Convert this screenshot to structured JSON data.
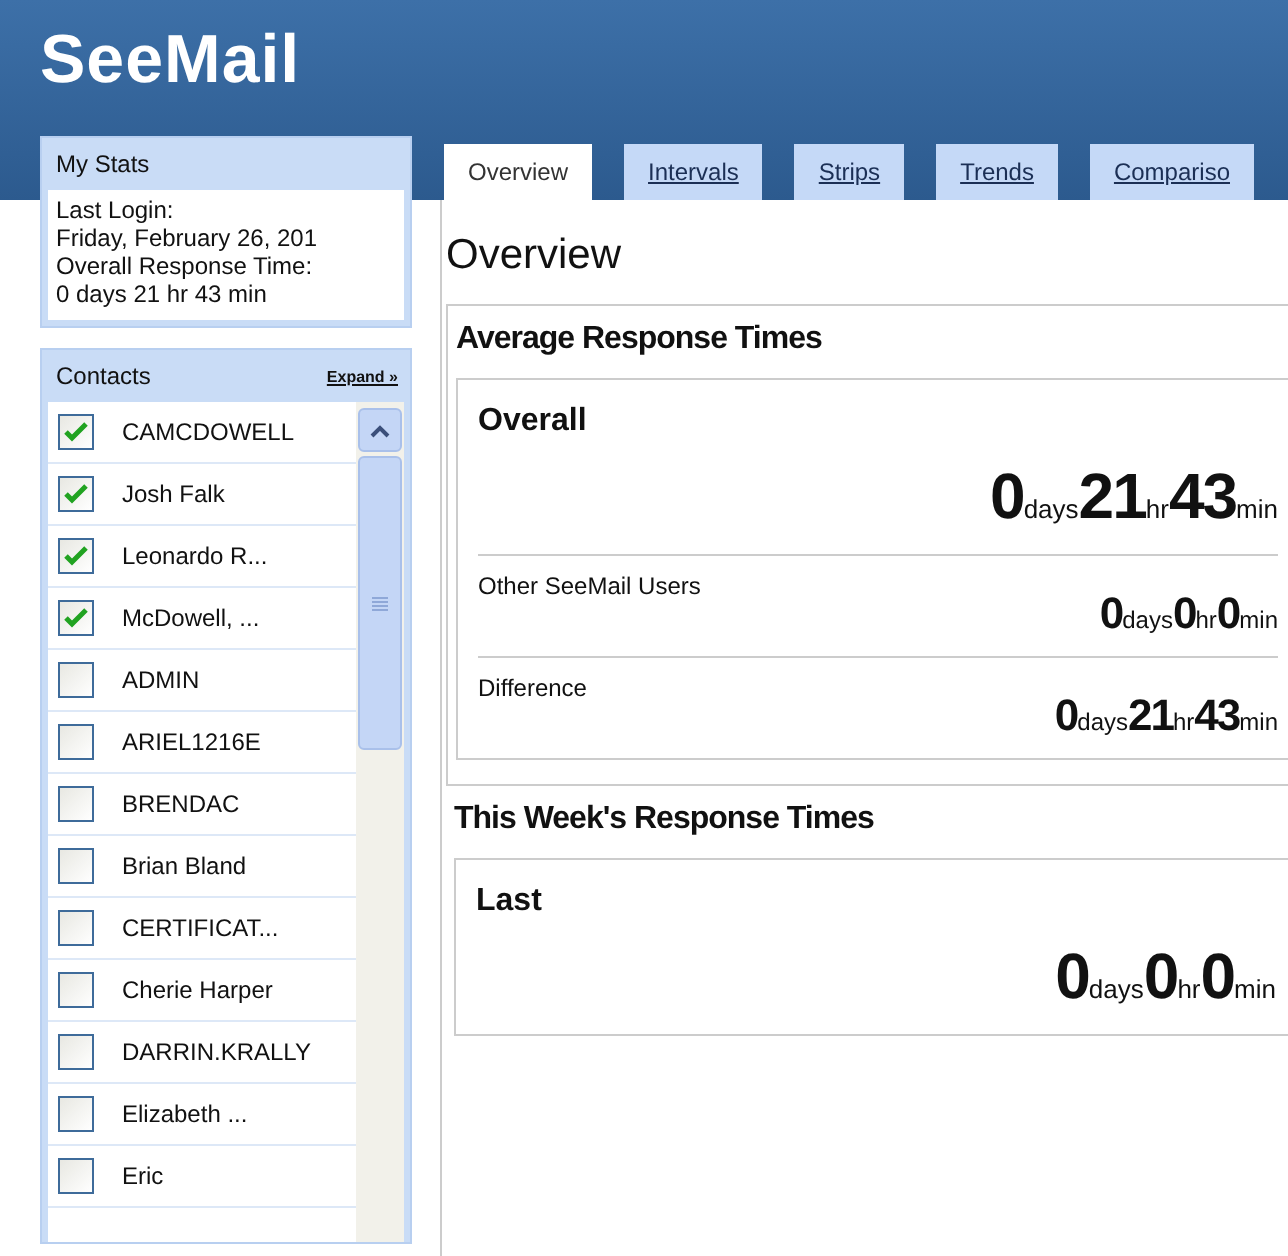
{
  "logo": "SeeMail",
  "my_stats": {
    "title": "My Stats",
    "lines": [
      "Last Login:",
      "Friday, February 26, 201",
      "Overall Response Time:",
      "0 days 21 hr 43 min"
    ]
  },
  "contacts": {
    "title": "Contacts",
    "expand_link": "Expand »",
    "items": [
      {
        "name": "CAMCDOWELL",
        "checked": true
      },
      {
        "name": "Josh Falk",
        "checked": true
      },
      {
        "name": "Leonardo R...",
        "checked": true
      },
      {
        "name": "McDowell, ...",
        "checked": true
      },
      {
        "name": "ADMIN",
        "checked": false
      },
      {
        "name": "ARIEL1216E",
        "checked": false
      },
      {
        "name": "BRENDAC",
        "checked": false
      },
      {
        "name": "Brian Bland",
        "checked": false
      },
      {
        "name": "CERTIFICAT...",
        "checked": false
      },
      {
        "name": "Cherie Harper",
        "checked": false
      },
      {
        "name": "DARRIN.KRALLY",
        "checked": false
      },
      {
        "name": "Elizabeth ...",
        "checked": false
      },
      {
        "name": "Eric",
        "checked": false
      }
    ]
  },
  "tabs": [
    {
      "label": "Overview",
      "selected": true
    },
    {
      "label": "Intervals",
      "selected": false
    },
    {
      "label": "Strips",
      "selected": false
    },
    {
      "label": "Trends",
      "selected": false
    },
    {
      "label": "Compariso",
      "selected": false
    }
  ],
  "page_title": "Overview",
  "sections": [
    {
      "title": "Average Response Times",
      "rows": [
        {
          "label": "Overall",
          "kind": "headline",
          "parts": [
            {
              "value": "0",
              "unit": "days"
            },
            {
              "value": "21",
              "unit": "hr"
            },
            {
              "value": "43",
              "unit": "min"
            }
          ]
        },
        {
          "label": "Other SeeMail Users",
          "kind": "compact",
          "parts": [
            {
              "value": "0",
              "unit": "days"
            },
            {
              "value": "0",
              "unit": "hr"
            },
            {
              "value": "0",
              "unit": "min"
            }
          ]
        },
        {
          "label": "Difference",
          "kind": "compact",
          "parts": [
            {
              "value": "0",
              "unit": "days"
            },
            {
              "value": "21",
              "unit": "hr"
            },
            {
              "value": "43",
              "unit": "min"
            }
          ]
        }
      ]
    },
    {
      "title": "This Week's Response Times",
      "rows": [
        {
          "label": "Last",
          "kind": "headline",
          "parts": [
            {
              "value": "0",
              "unit": "days"
            },
            {
              "value": "0",
              "unit": "hr"
            },
            {
              "value": "0",
              "unit": "min"
            }
          ]
        }
      ]
    }
  ]
}
